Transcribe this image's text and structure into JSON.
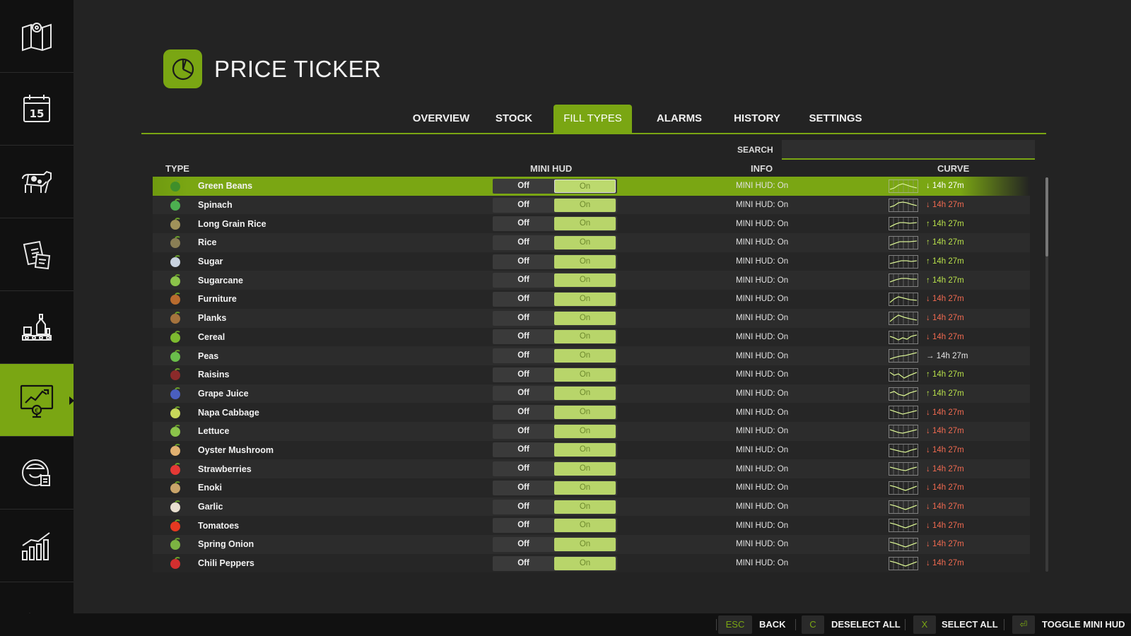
{
  "header": {
    "title": "PRICE TICKER",
    "icon": "pie-chart-icon"
  },
  "sidebar": {
    "items": [
      {
        "icon": "map-icon",
        "active": false
      },
      {
        "icon": "calendar-icon",
        "active": false,
        "label": "15"
      },
      {
        "icon": "cow-icon",
        "active": false
      },
      {
        "icon": "contracts-icon",
        "active": false
      },
      {
        "icon": "production-icon",
        "active": false
      },
      {
        "icon": "price-chart-icon",
        "active": true
      },
      {
        "icon": "farmer-icon",
        "active": false
      },
      {
        "icon": "statistics-icon",
        "active": false
      },
      {
        "icon": "misc-icon",
        "active": false
      }
    ]
  },
  "tabs": [
    {
      "label": "OVERVIEW",
      "active": false
    },
    {
      "label": "STOCK",
      "active": false
    },
    {
      "label": "FILL TYPES",
      "active": true
    },
    {
      "label": "ALARMS",
      "active": false
    },
    {
      "label": "HISTORY",
      "active": false
    },
    {
      "label": "SETTINGS",
      "active": false
    }
  ],
  "search": {
    "label": "SEARCH",
    "value": "",
    "placeholder": ""
  },
  "columns": {
    "type": "TYPE",
    "mini_hud": "MINI HUD",
    "info": "INFO",
    "curve": "CURVE"
  },
  "toggle": {
    "off": "Off",
    "on": "On"
  },
  "rows": [
    {
      "name": "Green Beans",
      "info": "MINI HUD: On",
      "trend": "down",
      "arrow": "↓",
      "time": "14h 27m",
      "icon_color": "#3f8f2a",
      "selected": true
    },
    {
      "name": "Spinach",
      "info": "MINI HUD: On",
      "trend": "down",
      "arrow": "↓",
      "time": "14h 27m",
      "icon_color": "#4caf50"
    },
    {
      "name": "Long Grain Rice",
      "info": "MINI HUD: On",
      "trend": "up",
      "arrow": "↑",
      "time": "14h 27m",
      "icon_color": "#a0915a"
    },
    {
      "name": "Rice",
      "info": "MINI HUD: On",
      "trend": "up",
      "arrow": "↑",
      "time": "14h 27m",
      "icon_color": "#8a7f55"
    },
    {
      "name": "Sugar",
      "info": "MINI HUD: On",
      "trend": "up",
      "arrow": "↑",
      "time": "14h 27m",
      "icon_color": "#c8d2e0"
    },
    {
      "name": "Sugarcane",
      "info": "MINI HUD: On",
      "trend": "up",
      "arrow": "↑",
      "time": "14h 27m",
      "icon_color": "#8bc34a"
    },
    {
      "name": "Furniture",
      "info": "MINI HUD: On",
      "trend": "down",
      "arrow": "↓",
      "time": "14h 27m",
      "icon_color": "#b86b2e"
    },
    {
      "name": "Planks",
      "info": "MINI HUD: On",
      "trend": "down",
      "arrow": "↓",
      "time": "14h 27m",
      "icon_color": "#a5733d"
    },
    {
      "name": "Cereal",
      "info": "MINI HUD: On",
      "trend": "down",
      "arrow": "↓",
      "time": "14h 27m",
      "icon_color": "#7dbb2f"
    },
    {
      "name": "Peas",
      "info": "MINI HUD: On",
      "trend": "flat",
      "arrow": "→",
      "time": "14h 27m",
      "icon_color": "#6abf4b"
    },
    {
      "name": "Raisins",
      "info": "MINI HUD: On",
      "trend": "up",
      "arrow": "↑",
      "time": "14h 27m",
      "icon_color": "#8b2a2a"
    },
    {
      "name": "Grape Juice",
      "info": "MINI HUD: On",
      "trend": "up",
      "arrow": "↑",
      "time": "14h 27m",
      "icon_color": "#4a5fc0"
    },
    {
      "name": "Napa Cabbage",
      "info": "MINI HUD: On",
      "trend": "down",
      "arrow": "↓",
      "time": "14h 27m",
      "icon_color": "#c8d85a"
    },
    {
      "name": "Lettuce",
      "info": "MINI HUD: On",
      "trend": "down",
      "arrow": "↓",
      "time": "14h 27m",
      "icon_color": "#8bc34a"
    },
    {
      "name": "Oyster Mushroom",
      "info": "MINI HUD: On",
      "trend": "down",
      "arrow": "↓",
      "time": "14h 27m",
      "icon_color": "#e0b070"
    },
    {
      "name": "Strawberries",
      "info": "MINI HUD: On",
      "trend": "down",
      "arrow": "↓",
      "time": "14h 27m",
      "icon_color": "#e53935"
    },
    {
      "name": "Enoki",
      "info": "MINI HUD: On",
      "trend": "down",
      "arrow": "↓",
      "time": "14h 27m",
      "icon_color": "#c9a46a"
    },
    {
      "name": "Garlic",
      "info": "MINI HUD: On",
      "trend": "down",
      "arrow": "↓",
      "time": "14h 27m",
      "icon_color": "#e8e0d0"
    },
    {
      "name": "Tomatoes",
      "info": "MINI HUD: On",
      "trend": "down",
      "arrow": "↓",
      "time": "14h 27m",
      "icon_color": "#e53920"
    },
    {
      "name": "Spring Onion",
      "info": "MINI HUD: On",
      "trend": "down",
      "arrow": "↓",
      "time": "14h 27m",
      "icon_color": "#7cb342"
    },
    {
      "name": "Chili Peppers",
      "info": "MINI HUD: On",
      "trend": "down",
      "arrow": "↓",
      "time": "14h 27m",
      "icon_color": "#d32f2f"
    }
  ],
  "footer": [
    {
      "key": "ESC",
      "label": "BACK"
    },
    {
      "key": "C",
      "label": "DESELECT ALL"
    },
    {
      "key": "X",
      "label": "SELECT ALL"
    },
    {
      "key": "⏎",
      "label": "TOGGLE MINI HUD"
    }
  ],
  "colors": {
    "accent": "#7aa613",
    "down": "#f06a50",
    "up": "#b8e04a",
    "toggle_on": "#b8d56a"
  }
}
